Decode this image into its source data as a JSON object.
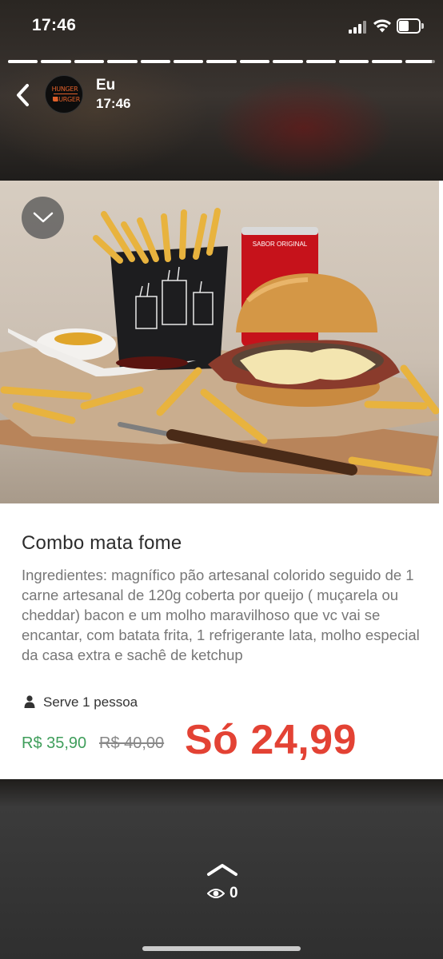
{
  "status_bar": {
    "time": "17:46",
    "icons": [
      "signal-icon",
      "wifi-icon",
      "battery-icon"
    ]
  },
  "story": {
    "segments_total": 13,
    "segments_viewed": 12,
    "current_segment_progress": 0.9
  },
  "header": {
    "poster_name": "Eu",
    "poster_time": "17:46",
    "avatar_logo_top": "HUNGER",
    "avatar_logo_bottom": "BURGER"
  },
  "product": {
    "title": "Combo mata fome",
    "description": "Ingredientes: magnífico  pão artesanal colorido seguido de 1 carne artesanal de 120g coberta por queijo ( muçarela ou cheddar) bacon e um molho maravilhoso que vc vai se encantar, com batata frita, 1 refrigerante lata, molho especial da casa extra e sachê de ketchup",
    "serves": "Serve 1 pessoa",
    "price": "R$ 35,90",
    "old_price": "R$ 40,00",
    "promo_text": "Só 24,99"
  },
  "photo": {
    "can_label": "SABOR ORIGINAL"
  },
  "footer": {
    "view_count": "0"
  },
  "colors": {
    "price_green": "#3f9e5b",
    "promo_red": "#e34234",
    "old_price_gray": "#888888",
    "logo_orange": "#e0602a"
  }
}
